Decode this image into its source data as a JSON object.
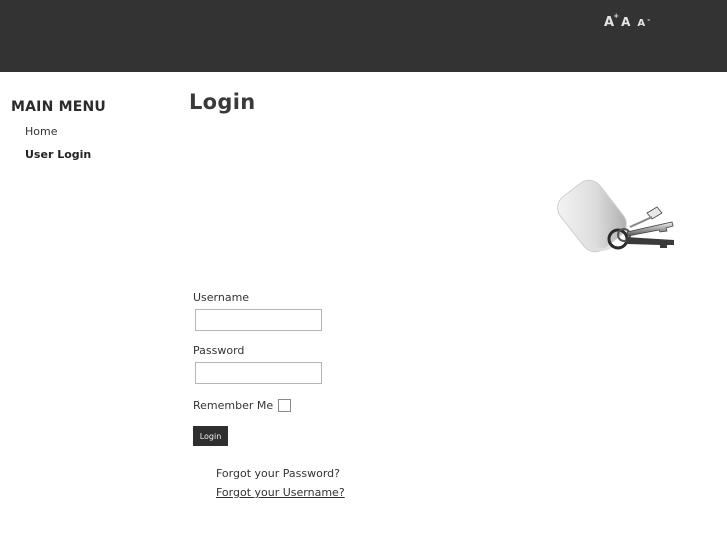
{
  "header": {
    "font_increase_label": "A",
    "font_increase_mark": "+",
    "font_reset_label": "A",
    "font_decrease_label": "A",
    "font_decrease_mark": "-",
    "background_color": "#333333"
  },
  "sidebar": {
    "title": "MAIN MENU",
    "items": [
      {
        "label": "Home",
        "active": false
      },
      {
        "label": "User Login",
        "active": true
      }
    ]
  },
  "main": {
    "title": "Login",
    "image_icon": "keys-icon"
  },
  "login_form": {
    "username_label": "Username",
    "username_value": "",
    "password_label": "Password",
    "password_value": "",
    "remember_label": "Remember Me",
    "remember_checked": false,
    "submit_label": "Login",
    "links": [
      {
        "label": "Forgot your Password?"
      },
      {
        "label": "Forgot your Username?"
      }
    ]
  }
}
